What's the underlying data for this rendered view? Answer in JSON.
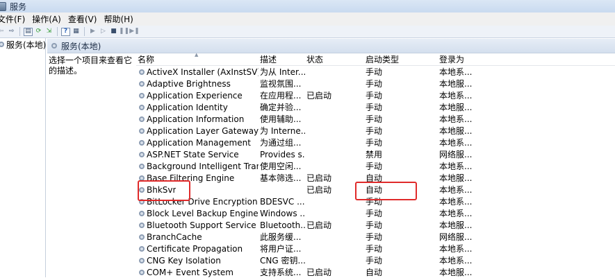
{
  "window": {
    "title": "服务"
  },
  "menu": [
    "文件(F)",
    "操作(A)",
    "查看(V)",
    "帮助(H)"
  ],
  "toolbar": {
    "buttons": [
      {
        "name": "back-icon",
        "glyph": "⇦"
      },
      {
        "name": "forward-icon",
        "glyph": "⇨"
      },
      {
        "name": "show-hide-tree-icon",
        "glyph": "▤"
      },
      {
        "name": "refresh-icon",
        "glyph": "⟳"
      },
      {
        "name": "export-list-icon",
        "glyph": "⇲"
      },
      {
        "name": "help-icon",
        "glyph": "?"
      },
      {
        "name": "properties-icon",
        "glyph": "▦"
      },
      {
        "name": "start-service-icon",
        "glyph": "▶"
      },
      {
        "name": "start-service-alt-icon",
        "glyph": "▷"
      },
      {
        "name": "stop-service-icon",
        "glyph": "■"
      },
      {
        "name": "pause-service-icon",
        "glyph": "❚❚"
      },
      {
        "name": "restart-service-icon",
        "glyph": "▶❚"
      }
    ]
  },
  "tree": {
    "root_label": "服务(本地)"
  },
  "main": {
    "header_title": "服务(本地)",
    "description_prompt": "选择一个项目来查看它的描述。",
    "columns": [
      "名称",
      "描述",
      "状态",
      "启动类型",
      "登录为"
    ],
    "rows": [
      {
        "name": "ActiveX Installer (AxInstSV)",
        "desc": "为从 Inter...",
        "status": "",
        "startup": "手动",
        "logon": "本地系..."
      },
      {
        "name": "Adaptive Brightness",
        "desc": "监视氛围...",
        "status": "",
        "startup": "手动",
        "logon": "本地服..."
      },
      {
        "name": "Application Experience",
        "desc": "在应用程...",
        "status": "已启动",
        "startup": "手动",
        "logon": "本地系..."
      },
      {
        "name": "Application Identity",
        "desc": "确定并验...",
        "status": "",
        "startup": "手动",
        "logon": "本地服..."
      },
      {
        "name": "Application Information",
        "desc": "使用辅助...",
        "status": "",
        "startup": "手动",
        "logon": "本地系..."
      },
      {
        "name": "Application Layer Gateway S...",
        "desc": "为 Interne...",
        "status": "",
        "startup": "手动",
        "logon": "本地服..."
      },
      {
        "name": "Application Management",
        "desc": "为通过组...",
        "status": "",
        "startup": "手动",
        "logon": "本地系..."
      },
      {
        "name": "ASP.NET State Service",
        "desc": "Provides s...",
        "status": "",
        "startup": "禁用",
        "logon": "网络服..."
      },
      {
        "name": "Background Intelligent Trans...",
        "desc": "使用空闲...",
        "status": "",
        "startup": "手动",
        "logon": "本地系..."
      },
      {
        "name": "Base Filtering Engine",
        "desc": "基本筛选...",
        "status": "已启动",
        "startup": "自动",
        "logon": "本地服..."
      },
      {
        "name": "BhkSvr",
        "desc": "",
        "status": "已启动",
        "startup": "自动",
        "logon": "本地系..."
      },
      {
        "name": "BitLocker Drive Encryption S...",
        "desc": "BDESVC ...",
        "status": "",
        "startup": "手动",
        "logon": "本地系..."
      },
      {
        "name": "Block Level Backup Engine S...",
        "desc": "Windows ...",
        "status": "",
        "startup": "手动",
        "logon": "本地系..."
      },
      {
        "name": "Bluetooth Support Service",
        "desc": "Bluetooth...",
        "status": "已启动",
        "startup": "手动",
        "logon": "本地服..."
      },
      {
        "name": "BranchCache",
        "desc": "此服务缓...",
        "status": "",
        "startup": "手动",
        "logon": "网络服..."
      },
      {
        "name": "Certificate Propagation",
        "desc": "将用户证...",
        "status": "",
        "startup": "手动",
        "logon": "本地系..."
      },
      {
        "name": "CNG Key Isolation",
        "desc": "CNG 密钥...",
        "status": "",
        "startup": "手动",
        "logon": "本地系..."
      },
      {
        "name": "COM+ Event System",
        "desc": "支持系统...",
        "status": "已启动",
        "startup": "自动",
        "logon": "本地服..."
      }
    ]
  }
}
